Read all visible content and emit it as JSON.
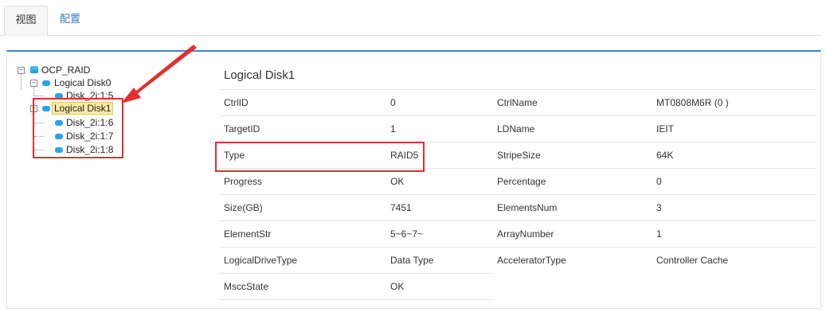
{
  "tabs": [
    {
      "label": "视图"
    },
    {
      "label": "配置"
    }
  ],
  "tree": {
    "root": "OCP_RAID",
    "ld0": "Logical Disk0",
    "ld0_disks": [
      "Disk_2i:1:5"
    ],
    "ld1": "Logical Disk1",
    "ld1_disks": [
      "Disk_2i:1:6",
      "Disk_2i:1:7",
      "Disk_2i:1:8"
    ]
  },
  "detail": {
    "title": "Logical Disk1",
    "left": [
      {
        "label": "CtrlID",
        "value": "0"
      },
      {
        "label": "TargetID",
        "value": "1"
      },
      {
        "label": "Type",
        "value": "RAID5"
      },
      {
        "label": "Progress",
        "value": "OK"
      },
      {
        "label": "Size(GB)",
        "value": "7451"
      },
      {
        "label": "ElementStr",
        "value": "5~6~7~"
      },
      {
        "label": "LogicalDriveType",
        "value": "Data Type"
      },
      {
        "label": "MsccState",
        "value": "OK"
      }
    ],
    "right": [
      {
        "label": "CtrlName",
        "value": "MT0808M6R (0 )"
      },
      {
        "label": "LDName",
        "value": "IEIT"
      },
      {
        "label": "StripeSize",
        "value": "64K"
      },
      {
        "label": "Percentage",
        "value": "0"
      },
      {
        "label": "ElementsNum",
        "value": "3"
      },
      {
        "label": "ArrayNumber",
        "value": "1"
      },
      {
        "label": "AcceleratorType",
        "value": "Controller Cache"
      }
    ]
  },
  "colors": {
    "accent": "#3a86c8",
    "link": "#3a7fbd",
    "selected_bg": "#fbeaa6",
    "annotation_red": "#e03030"
  },
  "icons": {
    "collapse_toggle": "minus-box-icon",
    "disk": "disk-icon",
    "database": "database-icon"
  }
}
